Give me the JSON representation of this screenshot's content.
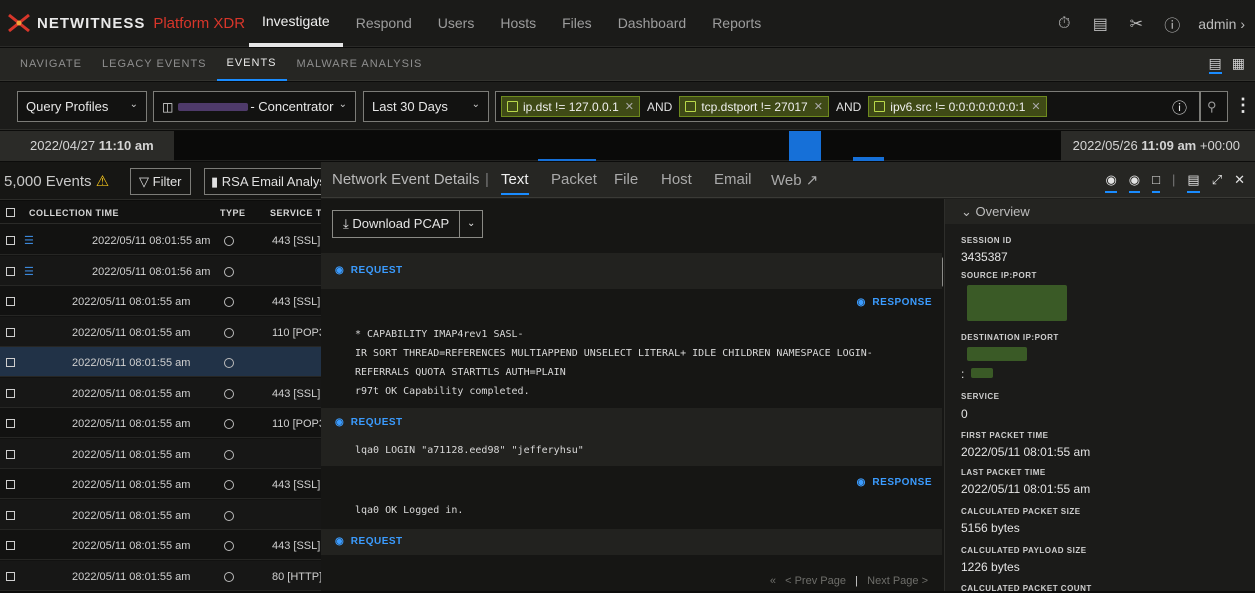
{
  "brand": {
    "name": "NETWITNESS",
    "product": "Platform XDR"
  },
  "topnav": {
    "items": [
      "Investigate",
      "Respond",
      "Users",
      "Hosts",
      "Files",
      "Dashboard",
      "Reports"
    ],
    "active": "Investigate",
    "user": "admin"
  },
  "subnav": {
    "items": [
      "NAVIGATE",
      "LEGACY EVENTS",
      "EVENTS",
      "MALWARE ANALYSIS"
    ],
    "active": "EVENTS"
  },
  "query": {
    "profiles_label": "Query Profiles",
    "service_suffix": "- Concentrator",
    "range_label": "Last 30 Days",
    "filters": [
      {
        "text": "ip.dst != 127.0.0.1"
      },
      {
        "text": "tcp.dstport != 27017"
      },
      {
        "text": "ipv6.src != 0:0:0:0:0:0:0:1"
      }
    ],
    "and_label": "AND"
  },
  "timeline": {
    "start_date": "2022/04/27",
    "start_time": "11:10 am",
    "end_date": "2022/05/26",
    "end_time": "11:09 am",
    "end_tz": "+00:00"
  },
  "events": {
    "count": "5,000 Events",
    "filter_label": "Filter",
    "rsa_label": "RSA Email Analysis",
    "columns": [
      "COLLECTION TIME",
      "TYPE",
      "SERVICE TY"
    ],
    "rows": [
      {
        "time": "2022/05/11 08:01:55 am",
        "service": "443 [SSL]",
        "stack": true
      },
      {
        "time": "2022/05/11 08:01:56 am",
        "service": "",
        "stack": true
      },
      {
        "time": "2022/05/11 08:01:55 am",
        "service": "443 [SSL]",
        "stack": false
      },
      {
        "time": "2022/05/11 08:01:55 am",
        "service": "110 [POP3",
        "stack": false
      },
      {
        "time": "2022/05/11 08:01:55 am",
        "service": "",
        "stack": false
      },
      {
        "time": "2022/05/11 08:01:55 am",
        "service": "443 [SSL]",
        "stack": false
      },
      {
        "time": "2022/05/11 08:01:55 am",
        "service": "110 [POP3",
        "stack": false
      },
      {
        "time": "2022/05/11 08:01:55 am",
        "service": "",
        "stack": false
      },
      {
        "time": "2022/05/11 08:01:55 am",
        "service": "443 [SSL]",
        "stack": false
      },
      {
        "time": "2022/05/11 08:01:55 am",
        "service": "",
        "stack": false
      },
      {
        "time": "2022/05/11 08:01:55 am",
        "service": "443 [SSL]",
        "stack": false
      },
      {
        "time": "2022/05/11 08:01:55 am",
        "service": "80 [HTTP]",
        "stack": false
      }
    ]
  },
  "details": {
    "title": "Network Event Details",
    "tabs": [
      "Text",
      "Packet",
      "File",
      "Host",
      "Email",
      "Web"
    ],
    "active_tab": "Text",
    "download_label": "Download PCAP",
    "request_label": "REQUEST",
    "response_label": "RESPONSE",
    "response1_lines": [
      "* CAPABILITY IMAP4rev1 SASL-",
      "IR SORT THREAD=REFERENCES MULTIAPPEND UNSELECT LITERAL+ IDLE CHILDREN NAMESPACE LOGIN-",
      "REFERRALS QUOTA STARTTLS AUTH=PLAIN",
      "r97t OK Capability completed."
    ],
    "request2_line": "lqa0 LOGIN \"a71128.eed98\" \"jefferyhsu\"",
    "response2_line": "lqa0 OK Logged in.",
    "prev_page": "< Prev Page",
    "next_page": "Next Page >",
    "page_sep": "|"
  },
  "overview": {
    "title": "Overview",
    "session_id_label": "SESSION ID",
    "session_id": "3435387",
    "source_label": "SOURCE IP:PORT",
    "dest_label": "DESTINATION IP:PORT",
    "dest_port_prefix": ":",
    "service_label": "SERVICE",
    "service": "0",
    "first_label": "FIRST PACKET TIME",
    "first": "2022/05/11 08:01:55 am",
    "last_label": "LAST PACKET TIME",
    "last": "2022/05/11 08:01:55 am",
    "size_label": "CALCULATED PACKET SIZE",
    "size": "5156 bytes",
    "payload_label": "CALCULATED PAYLOAD SIZE",
    "payload": "1226 bytes",
    "count_label": "CALCULATED PACKET COUNT"
  },
  "colors": {
    "accent": "#1a8cff",
    "brand_red": "#d8362a",
    "filter_pill": "#3f4a16",
    "selected_row": "#213247"
  },
  "icons": [
    "timer-icon",
    "report-icon",
    "tools-icon",
    "help-icon",
    "chevron-right-icon"
  ]
}
